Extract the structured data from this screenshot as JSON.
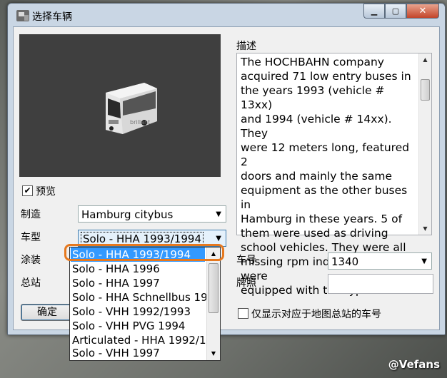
{
  "window": {
    "title": "选择车辆"
  },
  "preview": {
    "checkbox_label": "预览",
    "checked": true
  },
  "form": {
    "manufacturer_label": "制造",
    "manufacturer_value": "Hamburg citybus",
    "model_label": "车型",
    "model_value": "Solo - HHA 1993/1994",
    "livery_label": "涂装",
    "depot_label": "总站",
    "fleet_no_label": "车号",
    "fleet_no_value": "1340",
    "plate_label": "牌照",
    "plate_value": "",
    "filter_checkbox_label": "仅显示对应于地图总站的车号",
    "filter_checked": false,
    "ok_button": "确定"
  },
  "description": {
    "label": "描述",
    "text": "The HOCHBAHN company\nacquired 71 low entry buses in\nthe years 1993 (vehicle # 13xx)\nand 1994 (vehicle # 14xx). They\nwere 12 meters long, featured 2\ndoors and mainly the same\nequipment as the other buses in\nHamburg in these years. 5 of\nthem were used as driving\nschool vehicles. They were all\nmissing rpm indicators but were\nequipped with the typical"
  },
  "livery_dropdown": {
    "items": [
      "Solo - HHA 1993/1994",
      "Solo - HHA 1996",
      "Solo - HHA 1997",
      "Solo - HHA Schnellbus 19",
      "Solo - VHH 1992/1993",
      "Solo - VHH PVG 1994",
      "Articulated - HHA 1992/1",
      "Solo - VHH 1997"
    ],
    "selected_index": 0
  },
  "watermark": "@Vefans",
  "colors": {
    "selection": "#3399ff",
    "highlight_ring": "#e6781e"
  }
}
